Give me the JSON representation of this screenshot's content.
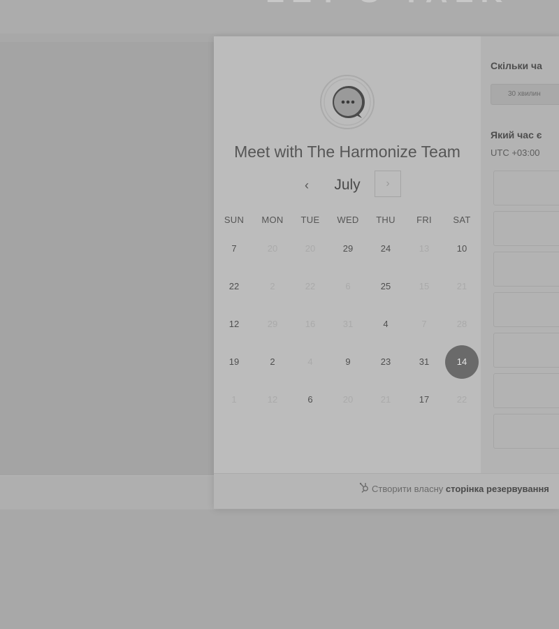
{
  "background": {
    "header_text": "LET'S TALK"
  },
  "profile": {
    "avatar_icon": "chat-bubble-icon",
    "title": "Meet with The Harmonize Team"
  },
  "calendar": {
    "prev_label": "‹",
    "month": "July",
    "next_label": "›",
    "weekdays": [
      "SUN",
      "MON",
      "TUE",
      "WED",
      "THU",
      "FRI",
      "SAT"
    ],
    "weeks": [
      [
        {
          "d": "7",
          "s": "avail"
        },
        {
          "d": "20",
          "s": "dim"
        },
        {
          "d": "20",
          "s": "dim"
        },
        {
          "d": "29",
          "s": "avail"
        },
        {
          "d": "24",
          "s": "avail"
        },
        {
          "d": "13",
          "s": "dim"
        },
        {
          "d": "10",
          "s": "avail"
        }
      ],
      [
        {
          "d": "22",
          "s": "avail"
        },
        {
          "d": "2",
          "s": "dim"
        },
        {
          "d": "22",
          "s": "dim"
        },
        {
          "d": "6",
          "s": "dim"
        },
        {
          "d": "25",
          "s": "avail"
        },
        {
          "d": "15",
          "s": "dim"
        },
        {
          "d": "21",
          "s": "dim"
        }
      ],
      [
        {
          "d": "12",
          "s": "avail"
        },
        {
          "d": "29",
          "s": "dim"
        },
        {
          "d": "16",
          "s": "dim"
        },
        {
          "d": "31",
          "s": "dim"
        },
        {
          "d": "4",
          "s": "avail"
        },
        {
          "d": "7",
          "s": "dim"
        },
        {
          "d": "28",
          "s": "dim"
        }
      ],
      [
        {
          "d": "19",
          "s": "avail"
        },
        {
          "d": "2",
          "s": "avail"
        },
        {
          "d": "4",
          "s": "dim"
        },
        {
          "d": "9",
          "s": "avail"
        },
        {
          "d": "23",
          "s": "avail"
        },
        {
          "d": "31",
          "s": "avail"
        },
        {
          "d": "14",
          "s": "sel"
        }
      ],
      [
        {
          "d": "1",
          "s": "dim"
        },
        {
          "d": "12",
          "s": "dim"
        },
        {
          "d": "6",
          "s": "avail"
        },
        {
          "d": "20",
          "s": "dim"
        },
        {
          "d": "21",
          "s": "dim"
        },
        {
          "d": "17",
          "s": "avail"
        },
        {
          "d": "22",
          "s": "dim"
        }
      ]
    ]
  },
  "booking": {
    "duration_heading": "Скільки ча",
    "duration_option": "30 хвилин",
    "time_heading": "Який час є",
    "timezone": "UTC +03:00",
    "slot_count": 7
  },
  "footer": {
    "icon": "sprocket-icon",
    "prefix": "Створити власну",
    "link": "сторінка резервування"
  },
  "colors": {
    "selected_day": "#6a6a6a",
    "overlay": "#a8a8a8"
  }
}
